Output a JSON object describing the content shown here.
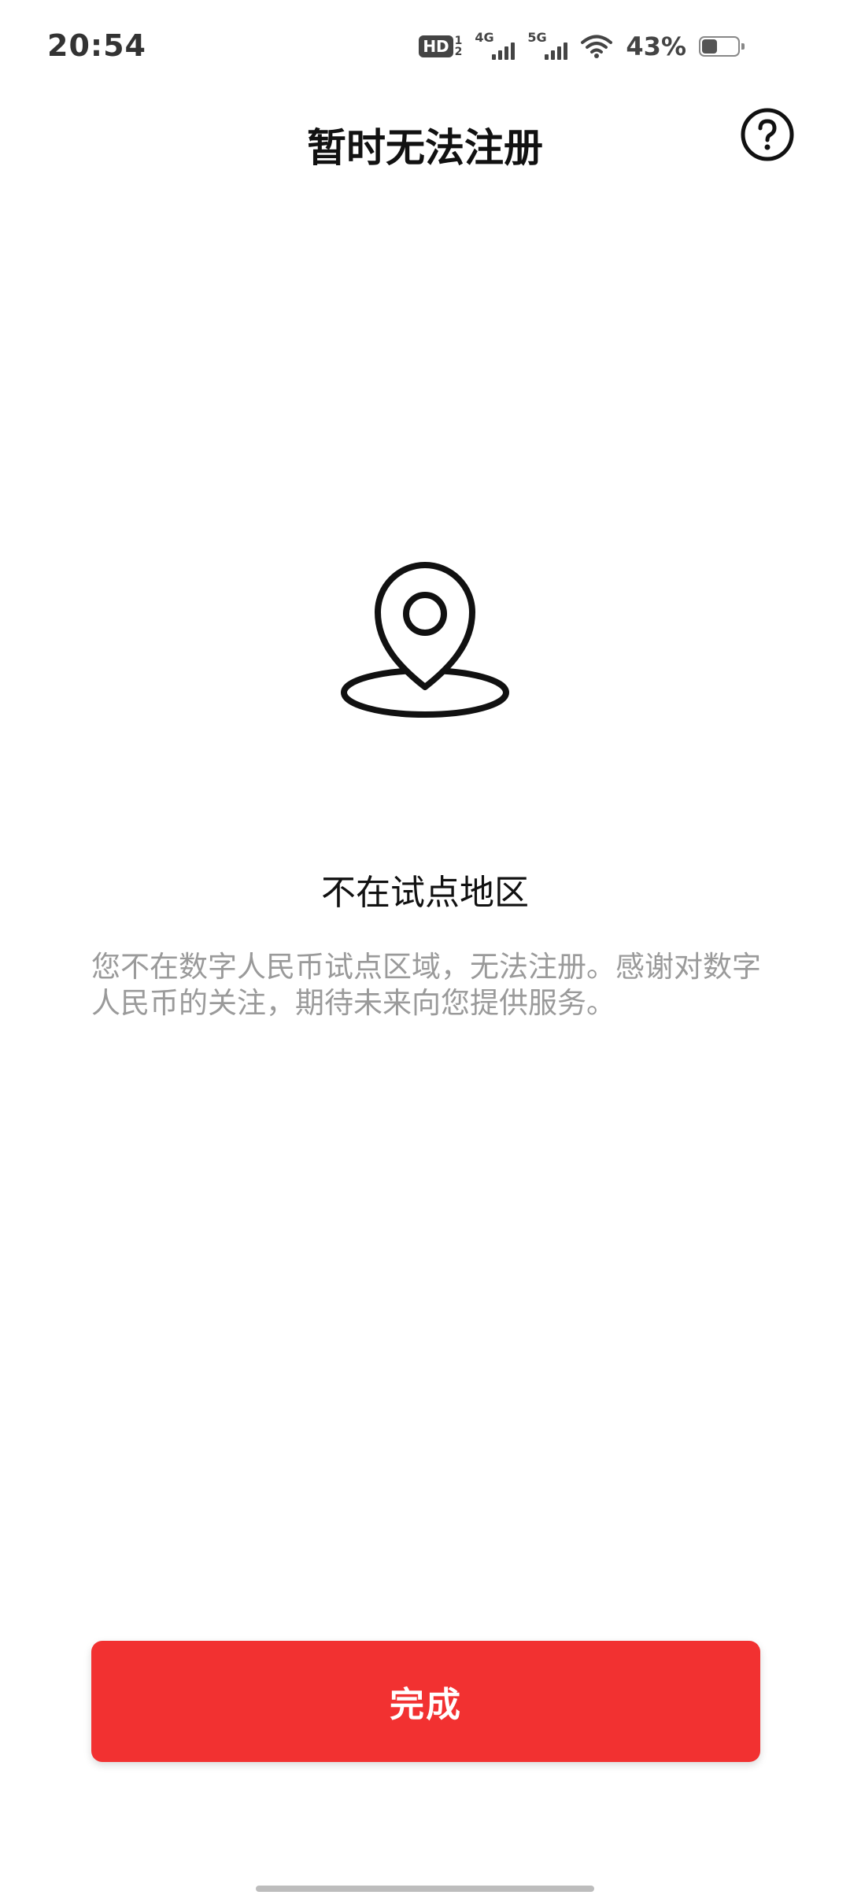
{
  "status_bar": {
    "time": "20:54",
    "hd_badge": "HD",
    "hd_sub_top": "1",
    "hd_sub_bottom": "2",
    "signal_1_label": "4G",
    "signal_2_label": "5G",
    "battery_percent": "43%",
    "battery_level": 0.43
  },
  "header": {
    "title": "暂时无法注册",
    "help_icon": "help-question-icon"
  },
  "main": {
    "illustration_icon": "location-pin-icon",
    "headline": "不在试点地区",
    "description": "您不在数字人民币试点区域，无法注册。感谢对数字人民币的关注，期待未来向您提供服务。"
  },
  "footer": {
    "done_label": "完成"
  },
  "colors": {
    "primary": "#f23131",
    "description_text": "#9a9a9a"
  }
}
